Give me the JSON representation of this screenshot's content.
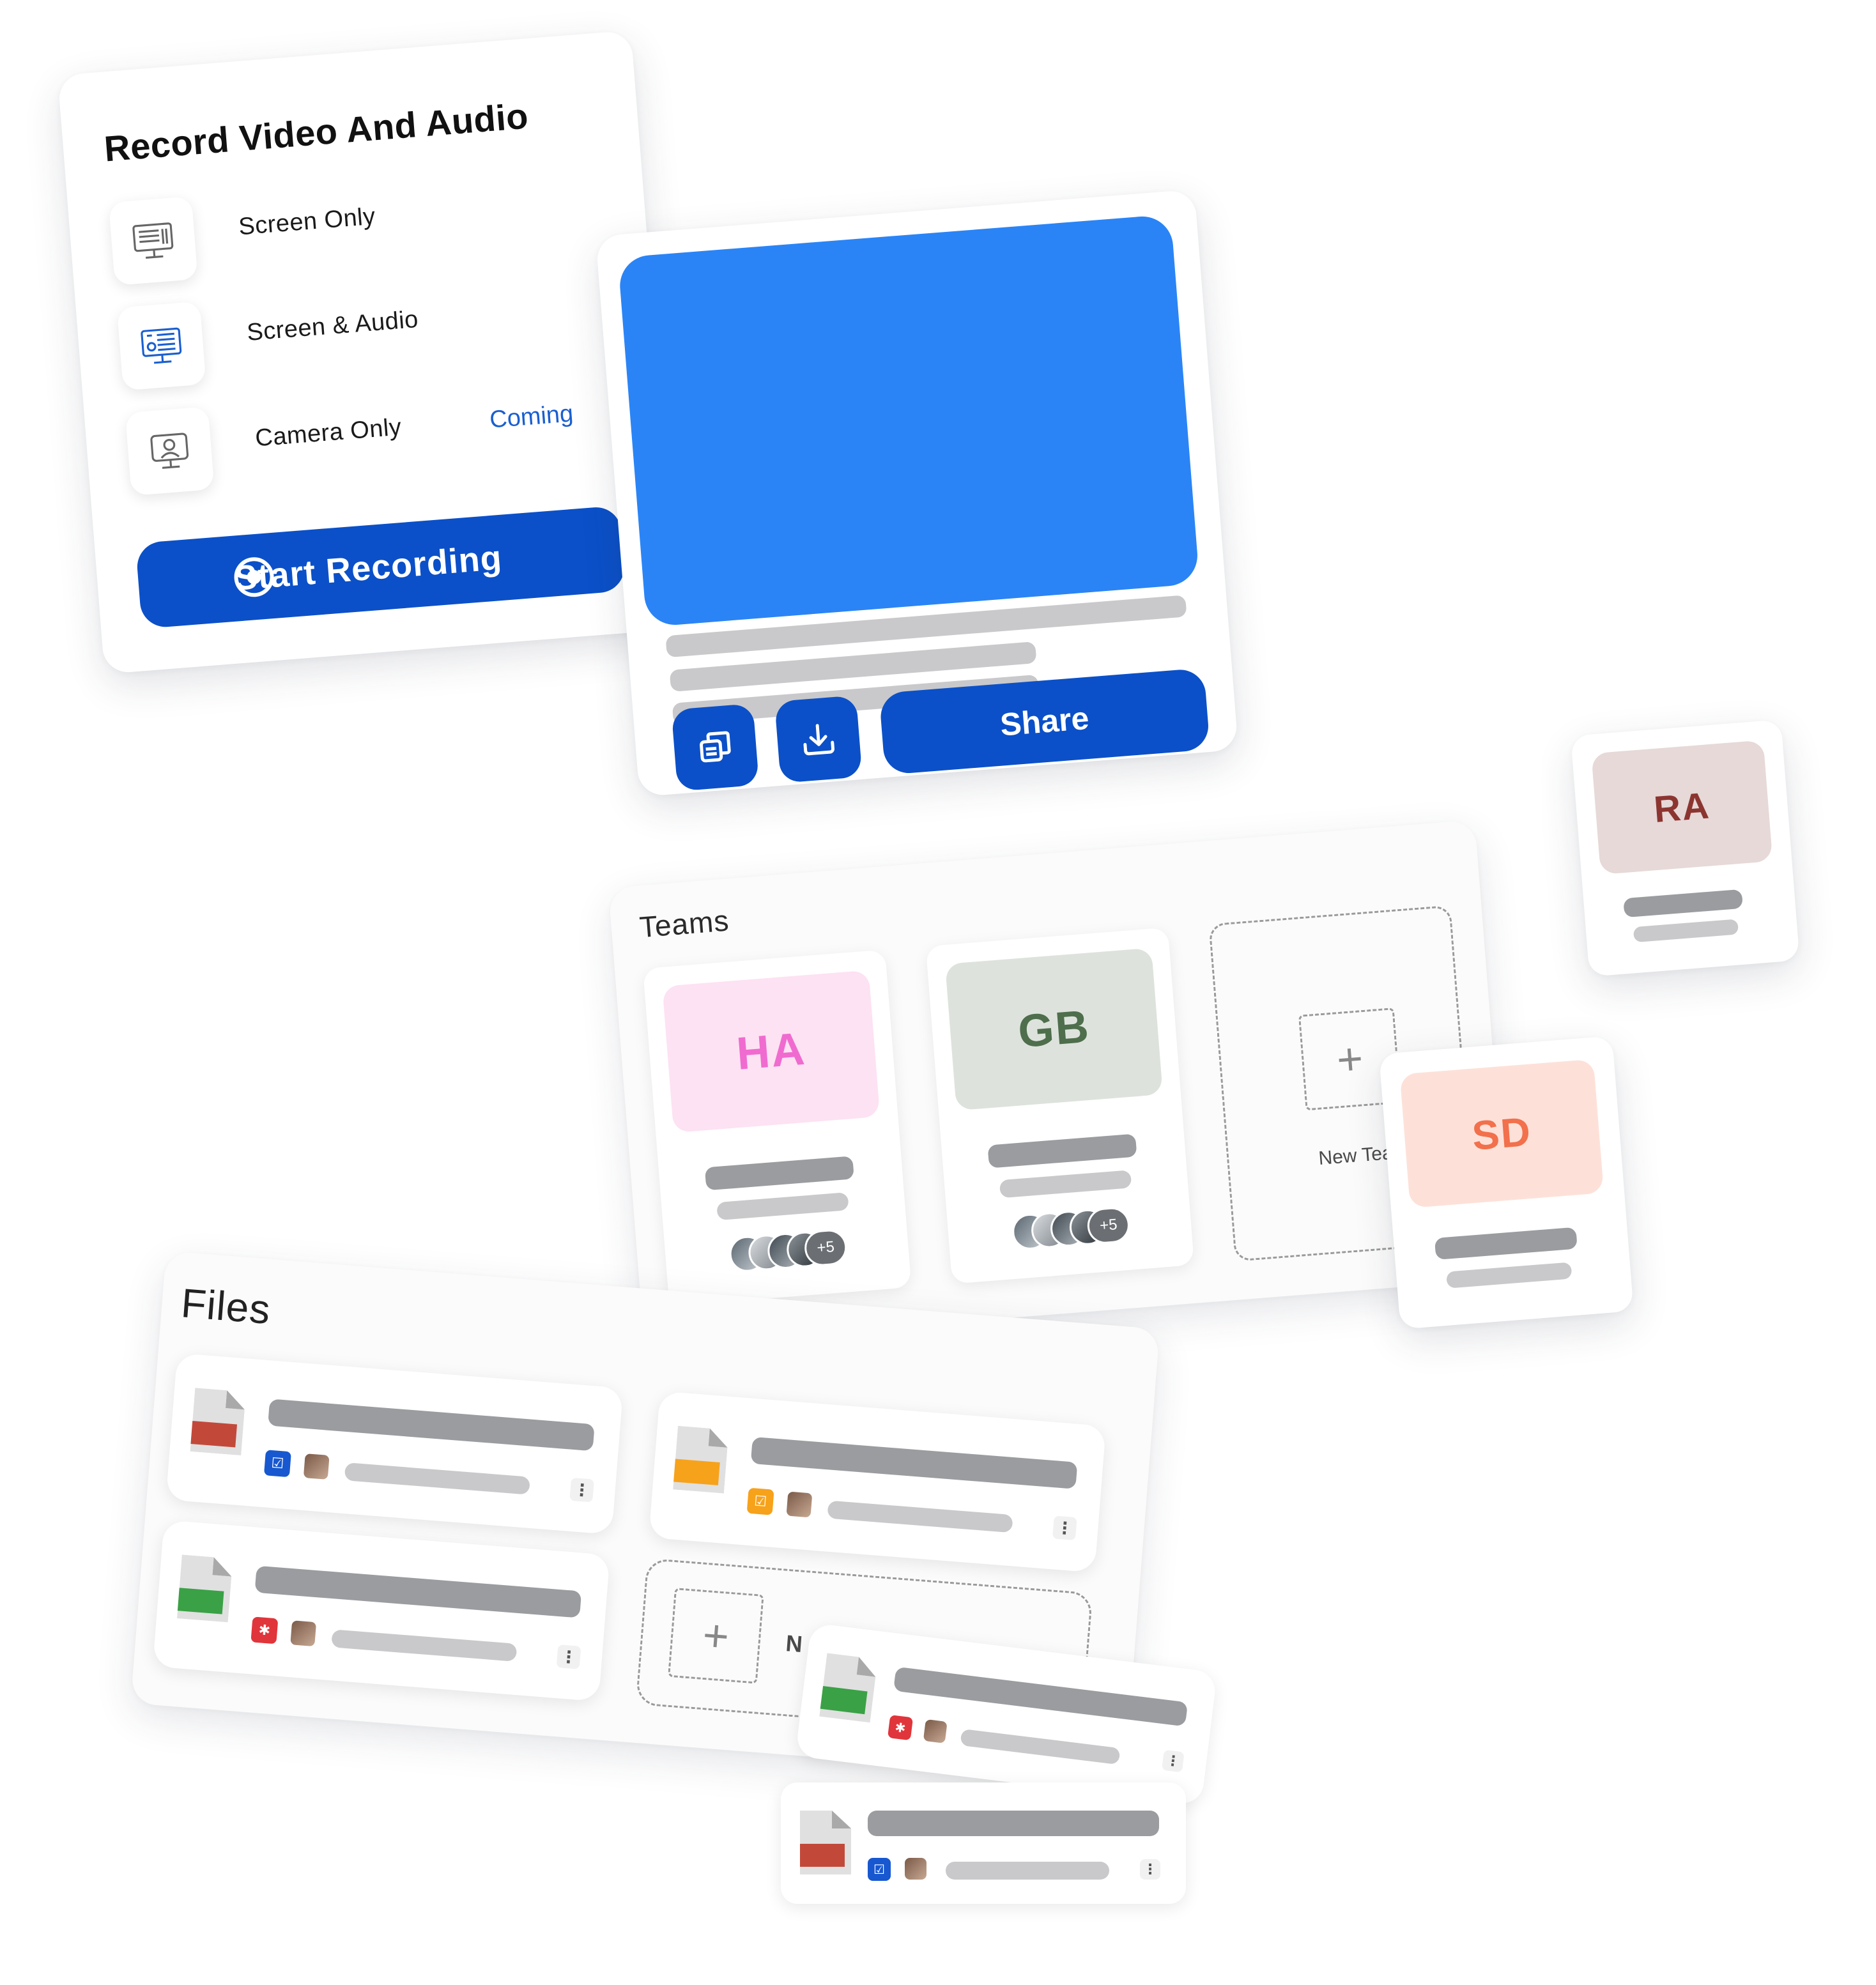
{
  "record": {
    "title": "Record Video And Audio",
    "options": [
      {
        "label": "Screen Only",
        "icon": "monitor-icon"
      },
      {
        "label": "Screen & Audio",
        "icon": "monitor-audio-icon"
      },
      {
        "label": "Camera Only",
        "icon": "webcam-icon"
      }
    ],
    "coming_label": "Coming",
    "start_button": "Start Recording"
  },
  "video": {
    "share_button": "Share",
    "copy_icon": "copy-icon",
    "download_icon": "download-icon"
  },
  "teams": {
    "heading": "Teams",
    "cards": [
      {
        "initials": "HA",
        "bg": "#fde2f3",
        "fg": "#f06bcf",
        "more": "+5"
      },
      {
        "initials": "GB",
        "bg": "#dde3dc",
        "fg": "#4e6e4c",
        "more": "+5"
      }
    ],
    "new_team_label": "New Tea",
    "floating": [
      {
        "initials": "RA",
        "bg": "#e6d9d8",
        "fg": "#8c3530"
      },
      {
        "initials": "SD",
        "bg": "#fde1d9",
        "fg": "#f2704b"
      }
    ]
  },
  "files": {
    "heading": "Files",
    "new_label": "N",
    "colors": {
      "red": "#c2493a",
      "orange": "#f7a21b",
      "green": "#3aa146",
      "blue": "#1758d0",
      "bug_red": "#e0353b"
    }
  }
}
